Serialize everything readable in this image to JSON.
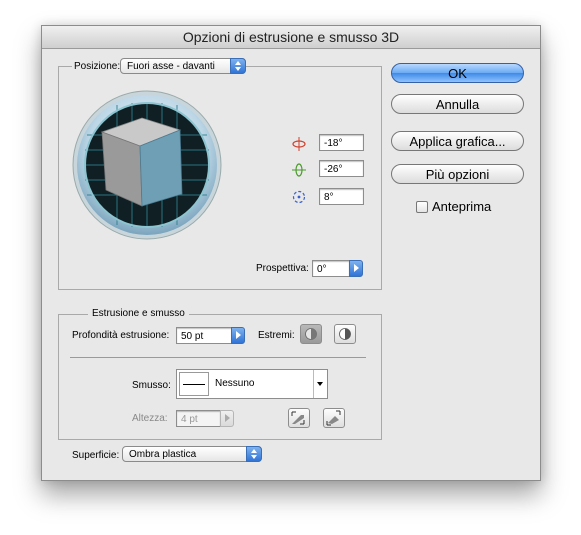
{
  "dialog": {
    "title": "Opzioni di estrusione e smusso 3D"
  },
  "position": {
    "label": "Posizione:",
    "value": "Fuori asse - davanti",
    "rotations": [
      {
        "icon": "x-axis-rotate-icon",
        "value": "-18°"
      },
      {
        "icon": "y-axis-rotate-icon",
        "value": "-26°"
      },
      {
        "icon": "z-axis-rotate-icon",
        "value": "8°"
      }
    ],
    "perspective_label": "Prospettiva:",
    "perspective_value": "0°"
  },
  "extrusion": {
    "group_title": "Estrusione e smusso",
    "depth_label": "Profondità estrusione:",
    "depth_value": "50 pt",
    "caps_label": "Estremi:",
    "bevel_label": "Smusso:",
    "bevel_value": "Nessuno",
    "height_label": "Altezza:",
    "height_value": "4 pt"
  },
  "surface": {
    "label": "Superficie:",
    "value": "Ombra plastica"
  },
  "buttons": {
    "ok": "OK",
    "cancel": "Annulla",
    "map_art": "Applica grafica...",
    "more_options": "Più opzioni"
  },
  "preview": {
    "label": "Anteprima",
    "checked": false
  },
  "colors": {
    "accent": "#3f8ae6",
    "cube_front": "#6f9fb5",
    "cube_side": "#9a9a9a",
    "cube_top": "#c8c8c8",
    "x_axis": "#d0402c",
    "y_axis": "#4a9a2c",
    "z_axis": "#3a5fd0"
  }
}
